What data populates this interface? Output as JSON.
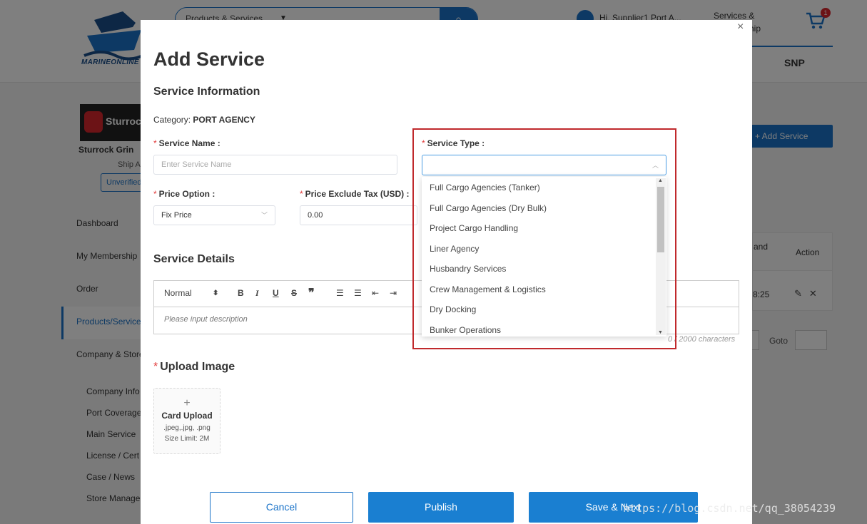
{
  "background": {
    "logo_text": "MARINEONLINE",
    "search_category": "Products & Services",
    "greeting": "Hi, Supplier1 Port A...",
    "services_line1": "Services &",
    "services_line2": "Membership",
    "cart_count": "1",
    "tab_snp": "SNP",
    "store_brand": "Sturrock",
    "store_name": "Sturrock Grin",
    "store_type": "Ship A",
    "verify_status": "Unverified",
    "add_service_label": "+ Add Service",
    "nav": [
      "Dashboard",
      "My Membership",
      "Order",
      "Products/Services",
      "Company & Store"
    ],
    "sub_nav": [
      "Company Info",
      "Port Coverage",
      "Main Service",
      "License / Cert",
      "Case / News",
      "Store Manage"
    ],
    "table_header_brand": "and",
    "table_header_action": "Action",
    "table_row_time": "8:25",
    "goto_label": "Goto"
  },
  "modal": {
    "title": "Add Service",
    "section_info": "Service Information",
    "category_label": "Category:",
    "category_value": "PORT AGENCY",
    "service_name_label": "Service Name",
    "service_name_placeholder": "Enter Service Name",
    "service_type_label": "Service Type",
    "service_type_options": [
      "Full Cargo Agencies (Tanker)",
      "Full Cargo Agencies (Dry Bulk)",
      "Project Cargo Handling",
      "Liner Agency",
      "Husbandry Services",
      "Crew Management & Logistics",
      "Dry Docking",
      "Bunker Operations"
    ],
    "price_option_label": "Price Option",
    "price_option_value": "Fix Price",
    "price_tax_label": "Price Exclude Tax (USD)",
    "price_tax_value": "0.00",
    "section_details": "Service Details",
    "editor_format": "Normal",
    "editor_placeholder": "Please input description",
    "char_count": "0 / 2000 characters",
    "section_upload": "Upload Image",
    "upload_plus": "+",
    "upload_title": "Card Upload",
    "upload_types": ".jpeg,.jpg, .png",
    "upload_limit": "Size Limit: 2M",
    "btn_cancel": "Cancel",
    "btn_publish": "Publish",
    "btn_save": "Save & Next",
    "close_glyph": "×"
  },
  "watermark": "https://blog.csdn.net/qq_38054239",
  "colors": {
    "primary": "#1a73c8",
    "required": "#e23a3a",
    "highlight_border": "#c0292c"
  }
}
